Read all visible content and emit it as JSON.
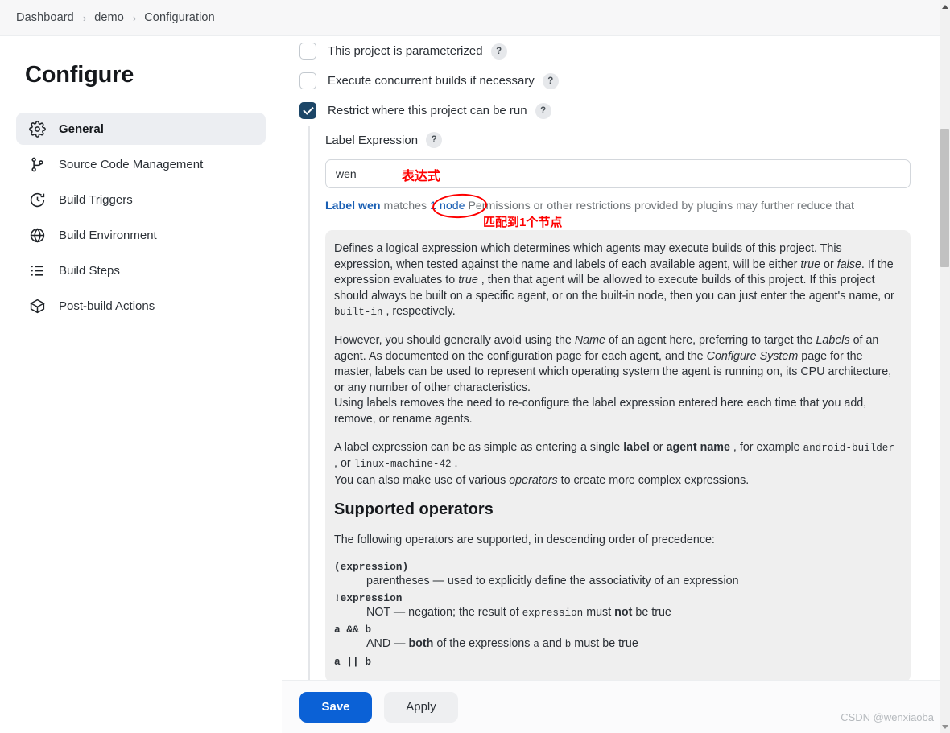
{
  "breadcrumb": {
    "items": [
      "Dashboard",
      "demo",
      "Configuration"
    ],
    "separator": "›"
  },
  "sidebar": {
    "title": "Configure",
    "items": [
      {
        "label": "General",
        "icon": "gear-icon",
        "active": true
      },
      {
        "label": "Source Code Management",
        "icon": "git-branch-icon",
        "active": false
      },
      {
        "label": "Build Triggers",
        "icon": "clock-icon",
        "active": false
      },
      {
        "label": "Build Environment",
        "icon": "globe-icon",
        "active": false
      },
      {
        "label": "Build Steps",
        "icon": "list-icon",
        "active": false
      },
      {
        "label": "Post-build Actions",
        "icon": "package-icon",
        "active": false
      }
    ]
  },
  "main": {
    "checkboxes": [
      {
        "label": "This project is parameterized",
        "checked": false,
        "help": "?"
      },
      {
        "label": "Execute concurrent builds if necessary",
        "checked": false,
        "help": "?"
      },
      {
        "label": "Restrict where this project can be run",
        "checked": true,
        "help": "?"
      }
    ],
    "label_expression": {
      "label": "Label Expression",
      "help": "?",
      "value": "wen",
      "placeholder": ""
    },
    "match_line": {
      "label_prefix": "Label wen",
      "matches_text": " matches ",
      "node_link": "1 node",
      "suffix": " Permissions or other restrictions provided by plugins may further reduce that"
    },
    "annotations": {
      "expression": "表达式",
      "matched_node": "匹配到1个节点"
    },
    "help": {
      "p1_a": "Defines a logical expression which determines which agents may execute builds of this project. This expression, when tested against the name and labels of each available agent, will be either ",
      "p1_true1": "true",
      "p1_b": " or ",
      "p1_false": "false",
      "p1_c": ". If the expression evaluates to ",
      "p1_true2": "true",
      "p1_d": " , then that agent will be allowed to execute builds of this project. If this project should always be built on a specific agent, or on the built-in node, then you can just enter the agent's name, or ",
      "p1_code": "built-in",
      "p1_e": " , respectively.",
      "p2_a": "However, you should generally avoid using the ",
      "p2_name": "Name",
      "p2_b": " of an agent here, preferring to target the ",
      "p2_labels": "Labels",
      "p2_c": " of an agent. As documented on the configuration page for each agent, and the ",
      "p2_configsys": "Configure System",
      "p2_d": " page for the master, labels can be used to represent which operating system the agent is running on, its CPU architecture, or any number of other characteristics.",
      "p2_e": "Using labels removes the need to re-configure the label expression entered here each time that you add, remove, or rename agents.",
      "p3_a": "A label expression can be as simple as entering a single ",
      "p3_label": "label",
      "p3_b": " or ",
      "p3_agentname": "agent name",
      "p3_c": " , for example ",
      "p3_code1": "android-builder",
      "p3_d": " , or ",
      "p3_code2": "linux-machine-42",
      "p3_e": " .",
      "p3_f_a": "You can also make use of various ",
      "p3_operators": "operators",
      "p3_f_b": " to create more complex expressions.",
      "supported_operators_heading": "Supported operators",
      "ops_intro": "The following operators are supported, in descending order of precedence:",
      "op1_term": "(expression)",
      "op1_desc": "parentheses — used to explicitly define the associativity of an expression",
      "op2_term": "!expression",
      "op2_desc_a": "NOT — negation; the result of ",
      "op2_desc_code": "expression",
      "op2_desc_b": " must ",
      "op2_desc_bold": "not",
      "op2_desc_c": " be true",
      "op3_term": "a && b",
      "op3_desc_a": "AND — ",
      "op3_desc_bold": "both",
      "op3_desc_b": " of the expressions ",
      "op3_desc_code1": "a",
      "op3_desc_c": " and ",
      "op3_desc_code2": "b",
      "op3_desc_d": " must be true",
      "op4_term": "a || b"
    }
  },
  "footer": {
    "save_label": "Save",
    "apply_label": "Apply"
  },
  "watermark": "CSDN @wenxiaoba",
  "colors": {
    "accent_blue": "#0b61d6",
    "link_blue": "#1a5fb4",
    "checkbox_checked": "#1c4667",
    "annotation_red": "#fe0000",
    "help_panel_bg": "#efefef"
  }
}
